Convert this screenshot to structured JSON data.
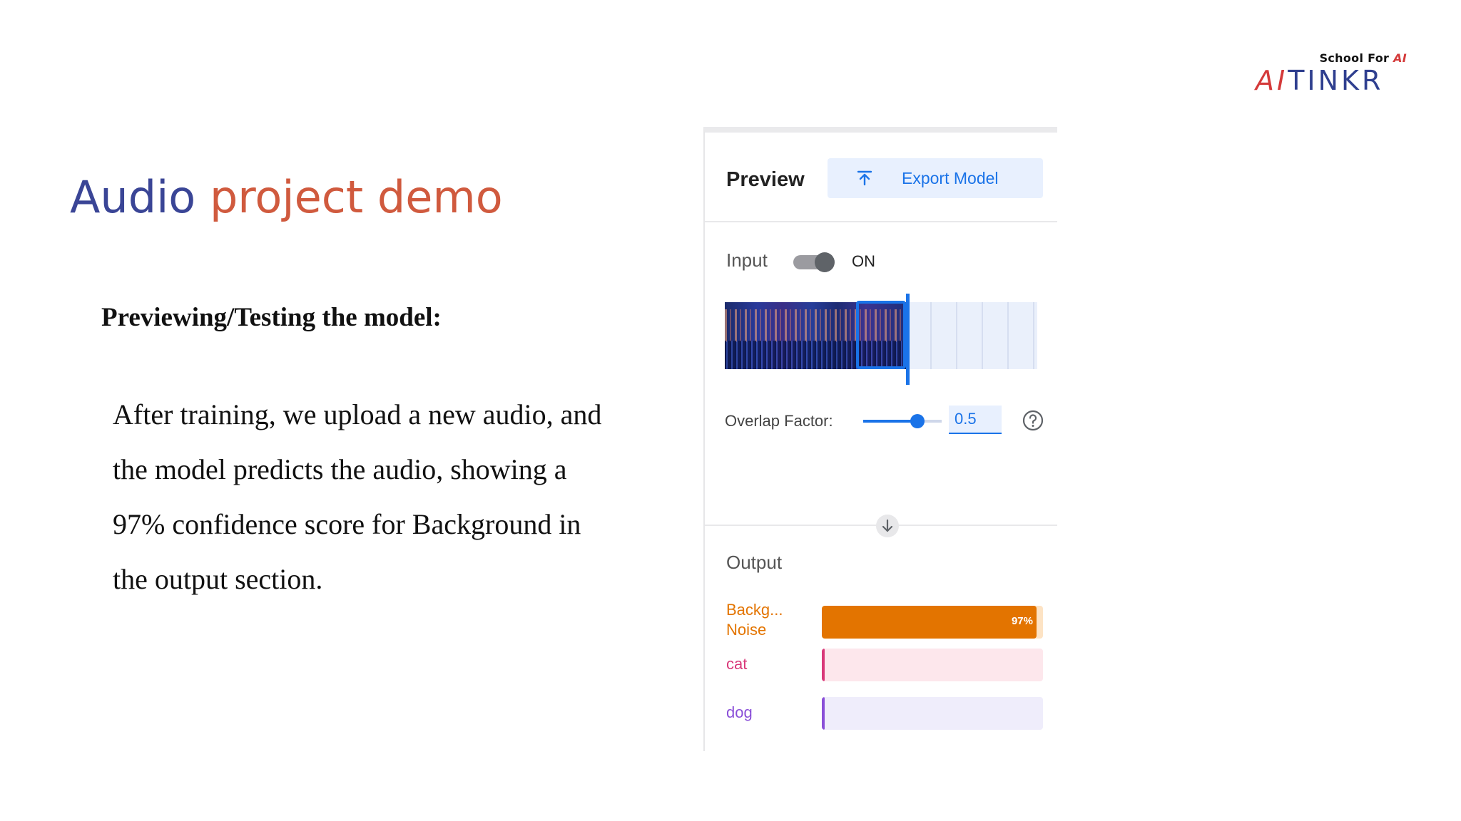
{
  "logo": {
    "tagline_prefix": "School For ",
    "tagline_ai": "AI",
    "brand_red": "AI",
    "brand_blue": "TINKR",
    "colors": {
      "red": "#d43a3a",
      "blue": "#2f3f8f"
    }
  },
  "slide": {
    "title_part1": "Audio",
    "title_part2": "project demo",
    "subheading": "Previewing/Testing the model:",
    "body_lines": [
      "After training, we upload a new audio, and",
      "the model predicts the  audio, showing a",
      "97% confidence score for Background in",
      "the output section."
    ],
    "colors": {
      "title_blue": "#3a4596",
      "title_orange": "#d05a3e"
    }
  },
  "panel": {
    "title": "Preview",
    "export_button": {
      "label": "Export Model",
      "icon": "upload-icon"
    },
    "input": {
      "label": "Input",
      "toggle_state": "ON",
      "toggle_on": true
    },
    "overlap": {
      "label": "Overlap Factor:",
      "value": "0.5",
      "slider_fraction": 0.5,
      "help_icon": "help-circle-icon"
    },
    "divider_icon": "arrow-down-icon",
    "output": {
      "label": "Output",
      "classes": [
        {
          "name_line1": "Backg...",
          "name_line2": "Noise",
          "confidence": 0.97,
          "percent_label": "97%",
          "color": "#e37400"
        },
        {
          "name_line1": "cat",
          "name_line2": "",
          "confidence": 0.01,
          "percent_label": "",
          "color": "#d93879"
        },
        {
          "name_line1": "dog",
          "name_line2": "",
          "confidence": 0.01,
          "percent_label": "",
          "color": "#8a4fd8"
        }
      ]
    },
    "colors": {
      "accent": "#1a73e8",
      "button_bg": "#e8f0fe"
    }
  }
}
